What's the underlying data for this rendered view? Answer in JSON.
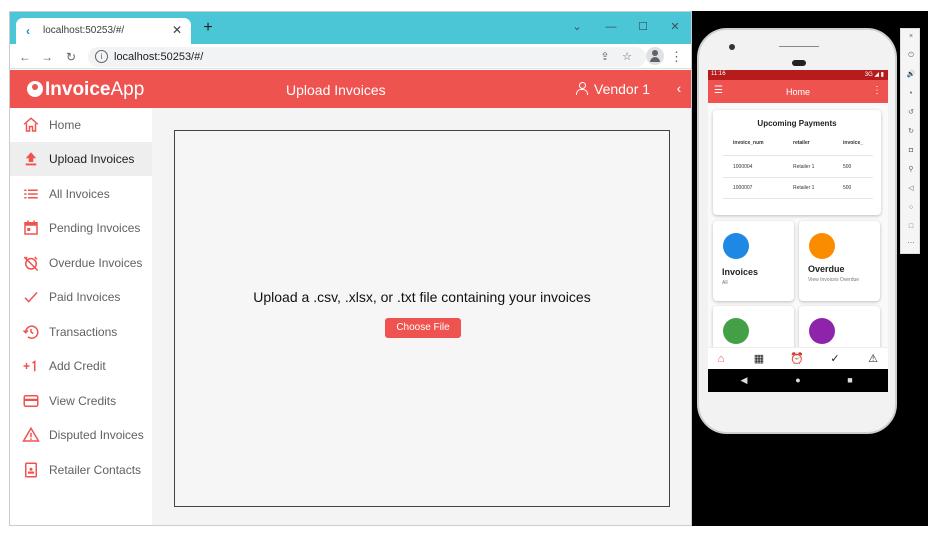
{
  "browser": {
    "tab_title": "localhost:50253/#/",
    "tab_close": "✕",
    "new_tab": "+",
    "url": "localhost:50253/#/"
  },
  "app": {
    "brand_bold": "Invoice",
    "brand_light": "App",
    "page_title": "Upload Invoices",
    "user": "Vendor 1",
    "colors": {
      "primary": "#ef5350",
      "tab_strip": "#4ac6d6"
    }
  },
  "sidebar": {
    "items": [
      {
        "label": "Home",
        "icon": "home-icon"
      },
      {
        "label": "Upload Invoices",
        "icon": "upload-icon",
        "active": true
      },
      {
        "label": "All Invoices",
        "icon": "list-icon"
      },
      {
        "label": "Pending Invoices",
        "icon": "calendar-icon"
      },
      {
        "label": "Overdue Invoices",
        "icon": "alarm-off-icon"
      },
      {
        "label": "Paid Invoices",
        "icon": "check-icon"
      },
      {
        "label": "Transactions",
        "icon": "history-icon"
      },
      {
        "label": "Add Credit",
        "icon": "plus-one-icon"
      },
      {
        "label": "View Credits",
        "icon": "credit-card-icon"
      },
      {
        "label": "Disputed Invoices",
        "icon": "warning-icon"
      },
      {
        "label": "Retailer Contacts",
        "icon": "contact-icon"
      }
    ]
  },
  "main": {
    "upload_prompt": "Upload a .csv, .xlsx, or .txt file containing your invoices",
    "choose_file": "Choose File"
  },
  "phone": {
    "time": "11:16",
    "signal": "3G ◢ ▮",
    "title": "Home",
    "upcoming": {
      "title": "Upcoming Payments",
      "headers": [
        "invoice_num",
        "retailer",
        "invoice_"
      ],
      "rows": [
        [
          "1000004",
          "Retailer 1",
          "500"
        ],
        [
          "1000007",
          "Retailer 1",
          "500"
        ]
      ]
    },
    "tiles": [
      {
        "title": "Invoices",
        "sub": "All",
        "color": "#1e88e5"
      },
      {
        "title": "Overdue",
        "sub": "View Invoices Overdue",
        "color": "#fb8c00"
      },
      {
        "title": "",
        "sub": "",
        "color": "#43a047"
      },
      {
        "title": "",
        "sub": "",
        "color": "#8e24aa"
      }
    ]
  }
}
